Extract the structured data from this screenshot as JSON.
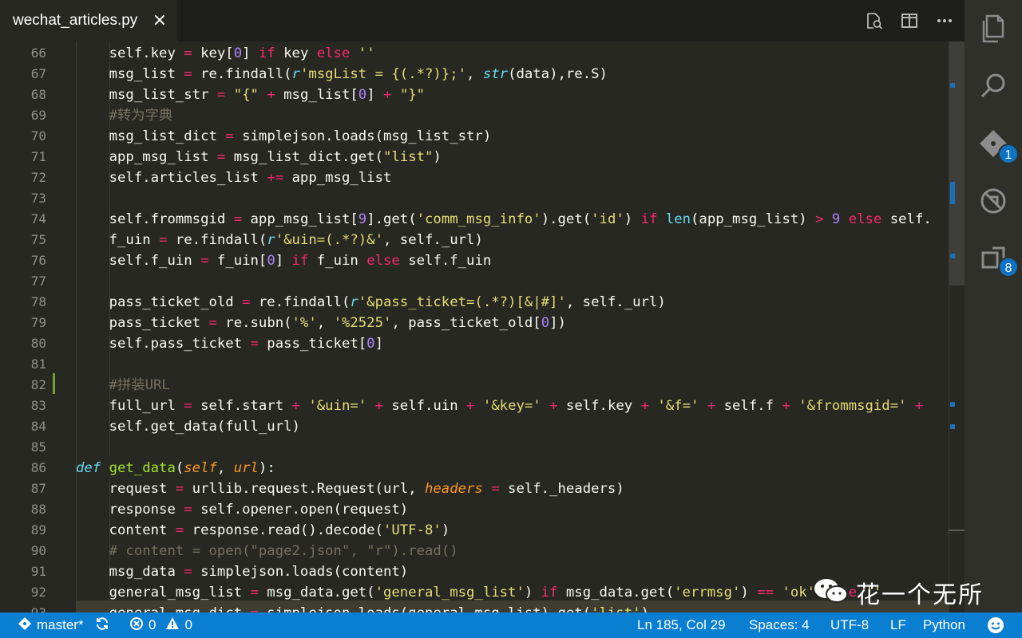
{
  "tab": {
    "title": "wechat_articles.py",
    "close_glyph": "×"
  },
  "tab_actions": [
    "open-changes-icon",
    "split-editor-icon",
    "more-actions-icon"
  ],
  "activity_bar": {
    "items": [
      {
        "icon": "explorer-icon",
        "badge": ""
      },
      {
        "icon": "search-icon",
        "badge": ""
      },
      {
        "icon": "source-control-icon",
        "badge": "1"
      },
      {
        "icon": "debug-icon",
        "badge": ""
      },
      {
        "icon": "extensions-icon",
        "badge": "8"
      }
    ]
  },
  "code": {
    "lines": [
      {
        "num": "66",
        "indent": "        ",
        "tokens": [
          [
            "",
            "self.key "
          ],
          [
            "k",
            "="
          ],
          [
            "",
            " key["
          ],
          [
            "n",
            "0"
          ],
          [
            "",
            "] "
          ],
          [
            "k",
            "if"
          ],
          [
            "",
            " key "
          ],
          [
            "k",
            "else"
          ],
          [
            "",
            " "
          ],
          [
            "s",
            "''"
          ]
        ]
      },
      {
        "num": "67",
        "indent": "        ",
        "tokens": [
          [
            "",
            "msg_list "
          ],
          [
            "k",
            "="
          ],
          [
            "",
            " re.findall("
          ],
          [
            "i",
            "r"
          ],
          [
            "s",
            "'msgList = {(.*?)};'"
          ],
          [
            "",
            ", "
          ],
          [
            "i",
            "str"
          ],
          [
            "",
            "(data),re.S)"
          ]
        ]
      },
      {
        "num": "68",
        "indent": "        ",
        "tokens": [
          [
            "",
            "msg_list_str "
          ],
          [
            "k",
            "="
          ],
          [
            "",
            " "
          ],
          [
            "s",
            "\"{\""
          ],
          [
            "",
            " "
          ],
          [
            "k",
            "+"
          ],
          [
            "",
            " msg_list["
          ],
          [
            "n",
            "0"
          ],
          [
            "",
            "] "
          ],
          [
            "k",
            "+"
          ],
          [
            "",
            " "
          ],
          [
            "s",
            "\"}\""
          ]
        ]
      },
      {
        "num": "69",
        "indent": "        ",
        "tokens": [
          [
            "c",
            "#转为字典"
          ]
        ]
      },
      {
        "num": "70",
        "indent": "        ",
        "tokens": [
          [
            "",
            "msg_list_dict "
          ],
          [
            "k",
            "="
          ],
          [
            "",
            " simplejson.loads(msg_list_str)"
          ]
        ]
      },
      {
        "num": "71",
        "indent": "        ",
        "tokens": [
          [
            "",
            "app_msg_list "
          ],
          [
            "k",
            "="
          ],
          [
            "",
            " msg_list_dict.get("
          ],
          [
            "s",
            "\"list\""
          ],
          [
            "",
            ")"
          ]
        ]
      },
      {
        "num": "72",
        "indent": "        ",
        "tokens": [
          [
            "",
            "self.articles_list "
          ],
          [
            "k",
            "+="
          ],
          [
            "",
            " app_msg_list"
          ]
        ]
      },
      {
        "num": "73",
        "indent": "",
        "tokens": []
      },
      {
        "num": "74",
        "indent": "        ",
        "tokens": [
          [
            "",
            "self.frommsgid "
          ],
          [
            "k",
            "="
          ],
          [
            "",
            " app_msg_list["
          ],
          [
            "n",
            "9"
          ],
          [
            "",
            "].get("
          ],
          [
            "s",
            "'comm_msg_info'"
          ],
          [
            "",
            ").get("
          ],
          [
            "s",
            "'id'"
          ],
          [
            "",
            ") "
          ],
          [
            "k",
            "if"
          ],
          [
            "",
            " "
          ],
          [
            "b",
            "len"
          ],
          [
            "",
            "(app_msg_list) "
          ],
          [
            "k",
            ">"
          ],
          [
            "",
            " "
          ],
          [
            "n",
            "9"
          ],
          [
            "",
            " "
          ],
          [
            "k",
            "else"
          ],
          [
            "",
            " self."
          ]
        ]
      },
      {
        "num": "75",
        "indent": "        ",
        "tokens": [
          [
            "",
            "f_uin "
          ],
          [
            "k",
            "="
          ],
          [
            "",
            " re.findall("
          ],
          [
            "i",
            "r"
          ],
          [
            "s",
            "'&uin=(.*?)&'"
          ],
          [
            "",
            ", self._url)"
          ]
        ]
      },
      {
        "num": "76",
        "indent": "        ",
        "tokens": [
          [
            "",
            "self.f_uin "
          ],
          [
            "k",
            "="
          ],
          [
            "",
            " f_uin["
          ],
          [
            "n",
            "0"
          ],
          [
            "",
            "] "
          ],
          [
            "k",
            "if"
          ],
          [
            "",
            " f_uin "
          ],
          [
            "k",
            "else"
          ],
          [
            "",
            " self.f_uin"
          ]
        ]
      },
      {
        "num": "77",
        "indent": "",
        "tokens": []
      },
      {
        "num": "78",
        "indent": "        ",
        "tokens": [
          [
            "",
            "pass_ticket_old "
          ],
          [
            "k",
            "="
          ],
          [
            "",
            " re.findall("
          ],
          [
            "i",
            "r"
          ],
          [
            "s",
            "'&pass_ticket=(.*?)[&|#]'"
          ],
          [
            "",
            ", self._url)"
          ]
        ]
      },
      {
        "num": "79",
        "indent": "        ",
        "tokens": [
          [
            "",
            "pass_ticket "
          ],
          [
            "k",
            "="
          ],
          [
            "",
            " re.subn("
          ],
          [
            "s",
            "'%'"
          ],
          [
            "",
            ", "
          ],
          [
            "s",
            "'%2525'"
          ],
          [
            "",
            ", pass_ticket_old["
          ],
          [
            "n",
            "0"
          ],
          [
            "",
            "])"
          ]
        ]
      },
      {
        "num": "80",
        "indent": "        ",
        "tokens": [
          [
            "",
            "self.pass_ticket "
          ],
          [
            "k",
            "="
          ],
          [
            "",
            " pass_ticket["
          ],
          [
            "n",
            "0"
          ],
          [
            "",
            "]"
          ]
        ]
      },
      {
        "num": "81",
        "indent": "",
        "tokens": []
      },
      {
        "num": "82",
        "indent": "        ",
        "tokens": [
          [
            "c",
            "#拼装URL"
          ]
        ]
      },
      {
        "num": "83",
        "indent": "        ",
        "tokens": [
          [
            "",
            "full_url "
          ],
          [
            "k",
            "="
          ],
          [
            "",
            " self.start "
          ],
          [
            "k",
            "+"
          ],
          [
            "",
            " "
          ],
          [
            "s",
            "'&uin='"
          ],
          [
            "",
            " "
          ],
          [
            "k",
            "+"
          ],
          [
            "",
            " self.uin "
          ],
          [
            "k",
            "+"
          ],
          [
            "",
            " "
          ],
          [
            "s",
            "'&key='"
          ],
          [
            "",
            " "
          ],
          [
            "k",
            "+"
          ],
          [
            "",
            " self.key "
          ],
          [
            "k",
            "+"
          ],
          [
            "",
            " "
          ],
          [
            "s",
            "'&f='"
          ],
          [
            "",
            " "
          ],
          [
            "k",
            "+"
          ],
          [
            "",
            " self.f "
          ],
          [
            "k",
            "+"
          ],
          [
            "",
            " "
          ],
          [
            "s",
            "'&frommsgid='"
          ],
          [
            "",
            " "
          ],
          [
            "k",
            "+"
          ]
        ]
      },
      {
        "num": "84",
        "indent": "        ",
        "tokens": [
          [
            "",
            "self.get_data(full_url)"
          ]
        ]
      },
      {
        "num": "85",
        "indent": "",
        "tokens": []
      },
      {
        "num": "86",
        "indent": "    ",
        "tokens": [
          [
            "i",
            "def"
          ],
          [
            "",
            " "
          ],
          [
            "f",
            "get_data"
          ],
          [
            "",
            "("
          ],
          [
            "p",
            "self"
          ],
          [
            "",
            ", "
          ],
          [
            "p",
            "url"
          ],
          [
            "",
            "):"
          ]
        ]
      },
      {
        "num": "87",
        "indent": "        ",
        "tokens": [
          [
            "",
            "request "
          ],
          [
            "k",
            "="
          ],
          [
            "",
            " urllib.request.Request(url, "
          ],
          [
            "p",
            "headers"
          ],
          [
            "",
            " "
          ],
          [
            "k",
            "="
          ],
          [
            "",
            " self._headers)"
          ]
        ]
      },
      {
        "num": "88",
        "indent": "        ",
        "tokens": [
          [
            "",
            "response "
          ],
          [
            "k",
            "="
          ],
          [
            "",
            " self.opener.open(request)"
          ]
        ]
      },
      {
        "num": "89",
        "indent": "        ",
        "tokens": [
          [
            "",
            "content "
          ],
          [
            "k",
            "="
          ],
          [
            "",
            " response.read().decode("
          ],
          [
            "s",
            "'UTF-8'"
          ],
          [
            "",
            ")"
          ]
        ]
      },
      {
        "num": "90",
        "indent": "        ",
        "tokens": [
          [
            "c",
            "# content = open(\"page2.json\", \"r\").read()"
          ]
        ]
      },
      {
        "num": "91",
        "indent": "        ",
        "tokens": [
          [
            "",
            "msg_data "
          ],
          [
            "k",
            "="
          ],
          [
            "",
            " simplejson.loads(content)"
          ]
        ]
      },
      {
        "num": "92",
        "indent": "        ",
        "tokens": [
          [
            "",
            "general_msg_list "
          ],
          [
            "k",
            "="
          ],
          [
            "",
            " msg_data.get("
          ],
          [
            "s",
            "'general_msg_list'"
          ],
          [
            "",
            ") "
          ],
          [
            "k",
            "if"
          ],
          [
            "",
            " msg_data.get("
          ],
          [
            "s",
            "'errmsg'"
          ],
          [
            "",
            ") "
          ],
          [
            "k",
            "=="
          ],
          [
            "",
            " "
          ],
          [
            "s",
            "'ok'"
          ],
          [
            "",
            " "
          ],
          [
            "k",
            "else"
          ],
          [
            "",
            " "
          ],
          [
            "s",
            "''"
          ]
        ]
      },
      {
        "num": "93",
        "indent": "        ",
        "tokens": [
          [
            "",
            "general_msg_dict "
          ],
          [
            "k",
            "="
          ],
          [
            "",
            " simplejson.loads(general_msg_list).get("
          ],
          [
            "s",
            "'list'"
          ],
          [
            "",
            ")"
          ]
        ]
      }
    ]
  },
  "watermark": {
    "text": "花一个无所",
    "icon": "wechat-icon"
  },
  "status_bar": {
    "branch": "master*",
    "errors": "0",
    "warnings": "0",
    "position": "Ln 185, Col 29",
    "spaces": "Spaces: 4",
    "encoding": "UTF-8",
    "eol": "LF",
    "language": "Python",
    "feedback_icon": "smiley-icon"
  }
}
